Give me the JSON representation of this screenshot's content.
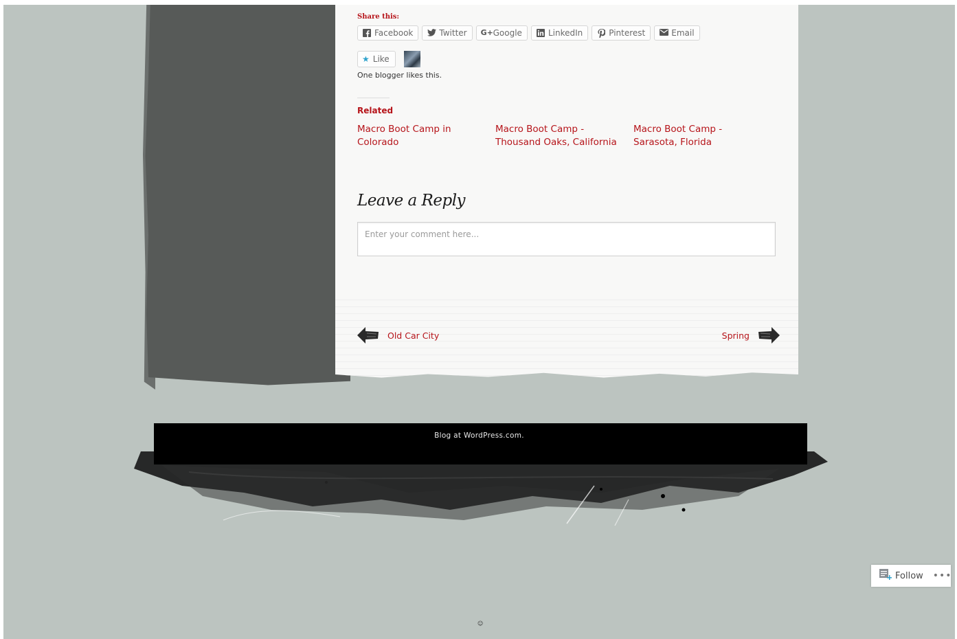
{
  "share": {
    "title": "Share this:",
    "buttons": [
      {
        "label": "Facebook",
        "icon": "facebook-icon"
      },
      {
        "label": "Twitter",
        "icon": "twitter-icon"
      },
      {
        "label": "Google",
        "icon": "google-plus-icon"
      },
      {
        "label": "LinkedIn",
        "icon": "linkedin-icon"
      },
      {
        "label": "Pinterest",
        "icon": "pinterest-icon"
      },
      {
        "label": "Email",
        "icon": "email-icon"
      }
    ]
  },
  "like": {
    "label": "Like",
    "icon": "star-icon",
    "likes_text": "One blogger likes this."
  },
  "related": {
    "title": "Related",
    "items": [
      "Macro Boot Camp in Colorado",
      "Macro Boot Camp - Thousand Oaks, California",
      "Macro Boot Camp - Sarasota, Florida"
    ]
  },
  "reply": {
    "title": "Leave a Reply",
    "placeholder": "Enter your comment here..."
  },
  "post_nav": {
    "prev_label": "Old Car City",
    "next_label": "Spring"
  },
  "footer": {
    "credit": "Blog at WordPress.com."
  },
  "follow": {
    "label": "Follow",
    "more": "•••"
  },
  "colors": {
    "accent": "#b6141a",
    "background": "#bcc4c0",
    "paper": "#f8f8f7",
    "left_panel": "#575a58",
    "like_star": "#2ea2cc"
  }
}
